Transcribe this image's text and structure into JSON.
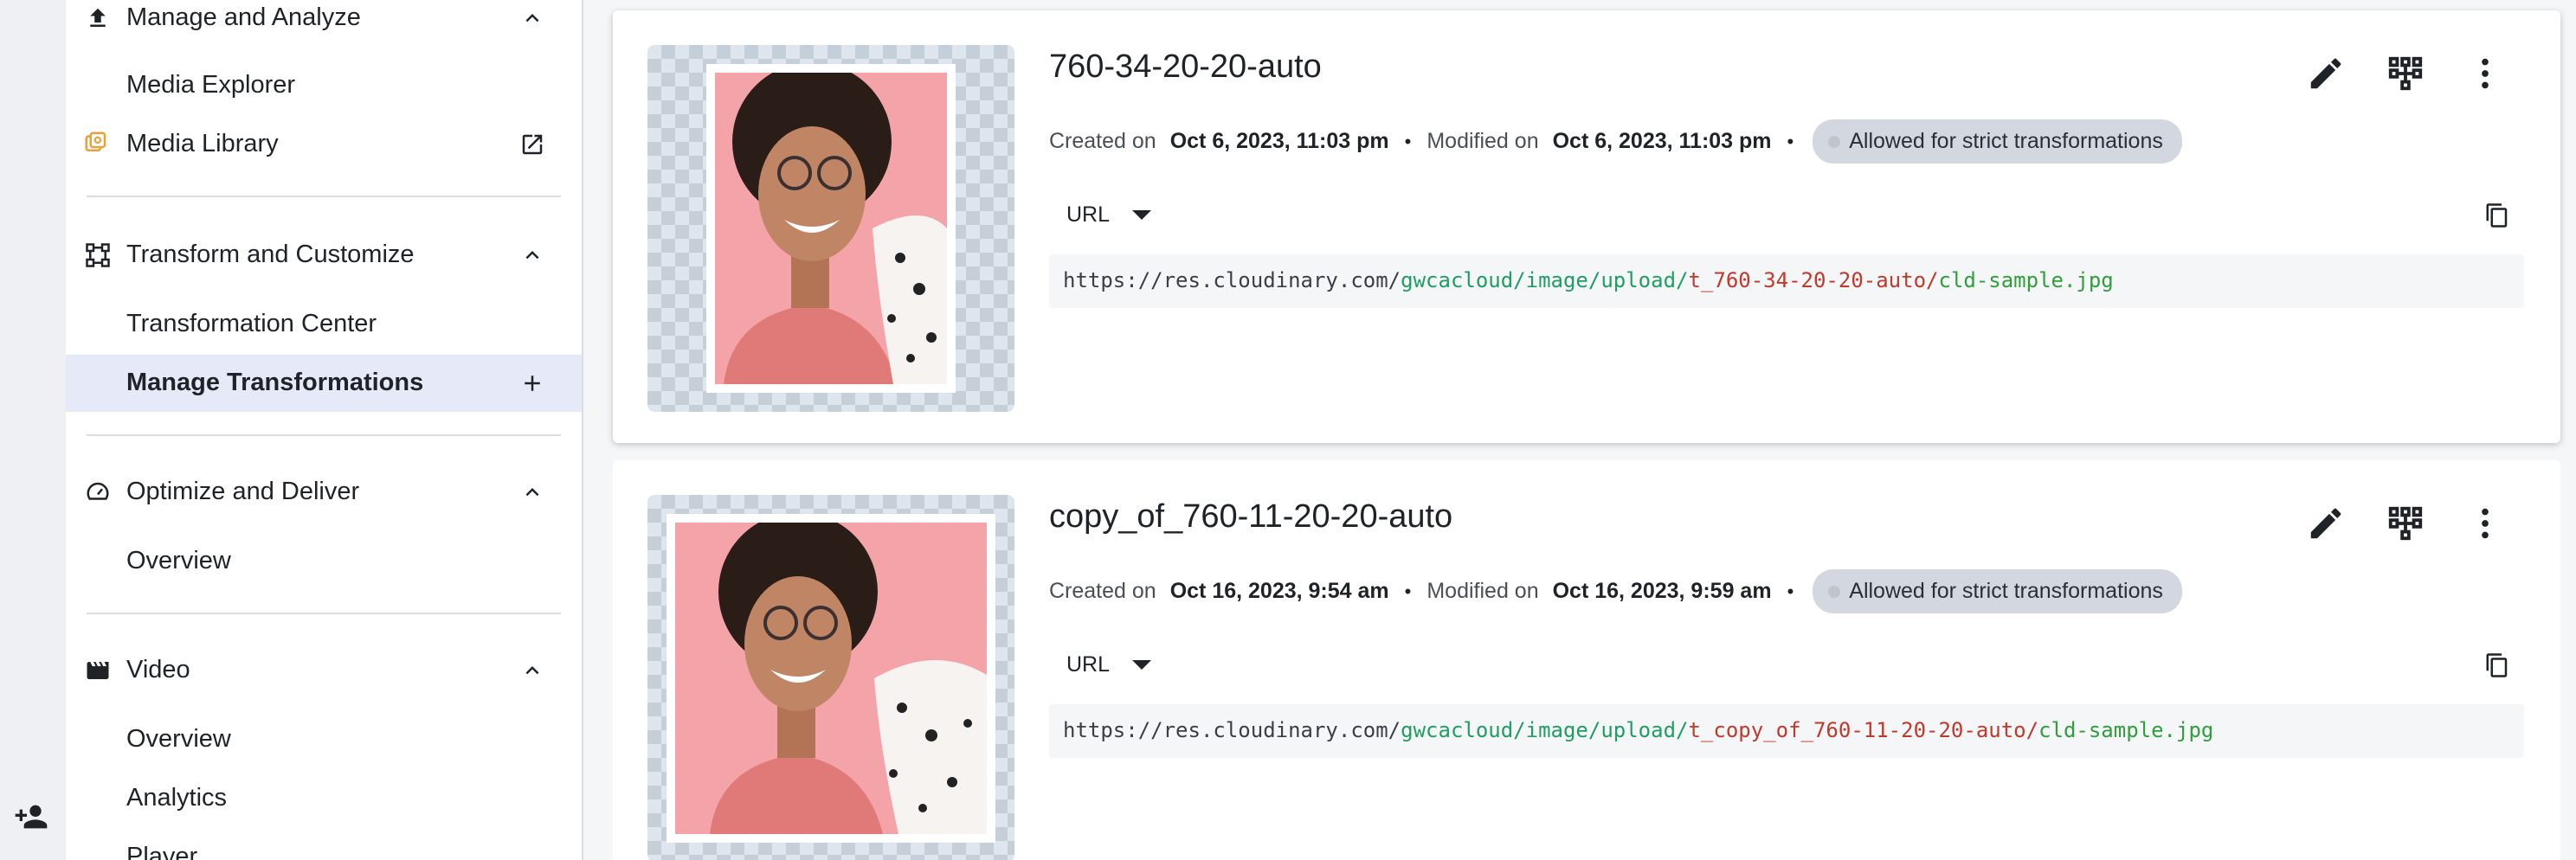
{
  "sidebar": {
    "sections": [
      {
        "title": "Manage and Analyze",
        "items": [
          "Media Explorer",
          "Media Library"
        ]
      },
      {
        "title": "Transform and Customize",
        "items": [
          "Transformation Center",
          "Manage Transformations"
        ]
      },
      {
        "title": "Optimize and Deliver",
        "items": [
          "Overview"
        ]
      },
      {
        "title": "Video",
        "items": [
          "Overview",
          "Analytics",
          "Player"
        ]
      }
    ]
  },
  "cards": [
    {
      "name": "760-34-20-20-auto",
      "created_label": "Created on",
      "created": "Oct 6, 2023, 11:03 pm",
      "modified_label": "Modified on",
      "modified": "Oct 6, 2023, 11:03 pm",
      "badge": "Allowed for strict transformations",
      "url_select": "URL",
      "url": {
        "base": "https://res.cloudinary.com/",
        "cloud": "gwcacloud/image/upload/",
        "transform": "t_760-34-20-20-auto/",
        "file": "cld-sample.jpg"
      }
    },
    {
      "name": "copy_of_760-11-20-20-auto",
      "created_label": "Created on",
      "created": "Oct 16, 2023, 9:54 am",
      "modified_label": "Modified on",
      "modified": "Oct 16, 2023, 9:59 am",
      "badge": "Allowed for strict transformations",
      "url_select": "URL",
      "url": {
        "base": "https://res.cloudinary.com/",
        "cloud": "gwcacloud/image/upload/",
        "transform": "t_copy_of_760-11-20-20-auto/",
        "file": "cld-sample.jpg"
      }
    }
  ],
  "icons": {
    "rail": "add-user-icon",
    "actions": [
      "edit-icon",
      "hierarchy-icon",
      "more-vert-icon"
    ],
    "copy": "copy-icon"
  },
  "colors": {
    "active_bg": "#e6e9f8",
    "url_cloud": "#1f9e63",
    "url_transform": "#c0392b",
    "url_file": "#2f9f3a"
  }
}
